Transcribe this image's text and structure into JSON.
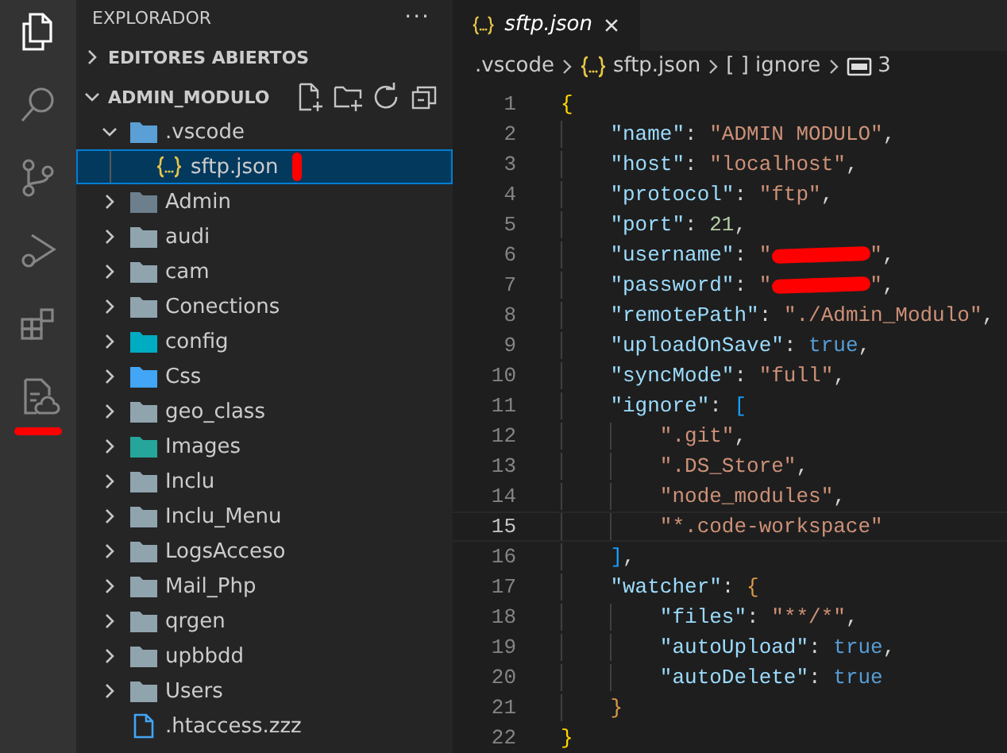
{
  "activity_bar": [
    {
      "kind": "explorer",
      "selected": true,
      "marked": false
    },
    {
      "kind": "search",
      "selected": false,
      "marked": false
    },
    {
      "kind": "source-control",
      "selected": false,
      "marked": false
    },
    {
      "kind": "run",
      "selected": false,
      "marked": false
    },
    {
      "kind": "extensions",
      "selected": false,
      "marked": false
    },
    {
      "kind": "sftp",
      "selected": false,
      "marked": true
    }
  ],
  "sidebar": {
    "title": "EXPLORADOR",
    "more": "···",
    "sections": [
      {
        "label": "EDITORES ABIERTOS",
        "expanded": false
      },
      {
        "label": "ADMIN_MODULO",
        "expanded": true,
        "children": [
          {
            "label": ".vscode",
            "kind": "folder",
            "color": "#5a9fd6",
            "expanded": true,
            "selected": false,
            "marked": false,
            "children": [
              {
                "label": "sftp.json",
                "kind": "json",
                "selected": true,
                "marked": true
              }
            ]
          },
          {
            "label": "Admin",
            "kind": "folder",
            "color": "#6d7f8c",
            "expanded": false,
            "selected": false,
            "marked": false
          },
          {
            "label": "audi",
            "kind": "folder",
            "color": "#90a4ae",
            "expanded": false,
            "selected": false,
            "marked": false
          },
          {
            "label": "cam",
            "kind": "folder",
            "color": "#90a4ae",
            "expanded": false,
            "selected": false,
            "marked": false
          },
          {
            "label": "Conections",
            "kind": "folder",
            "color": "#90a4ae",
            "expanded": false,
            "selected": false,
            "marked": false
          },
          {
            "label": "config",
            "kind": "folder",
            "color": "#00acc1",
            "expanded": false,
            "selected": false,
            "marked": false
          },
          {
            "label": "Css",
            "kind": "folder",
            "color": "#42a5f5",
            "expanded": false,
            "selected": false,
            "marked": false
          },
          {
            "label": "geo_class",
            "kind": "folder",
            "color": "#90a4ae",
            "expanded": false,
            "selected": false,
            "marked": false
          },
          {
            "label": "Images",
            "kind": "folder",
            "color": "#26a69a",
            "expanded": false,
            "selected": false,
            "marked": false
          },
          {
            "label": "Inclu",
            "kind": "folder",
            "color": "#90a4ae",
            "expanded": false,
            "selected": false,
            "marked": false
          },
          {
            "label": "Inclu_Menu",
            "kind": "folder",
            "color": "#90a4ae",
            "expanded": false,
            "selected": false,
            "marked": false
          },
          {
            "label": "LogsAcceso",
            "kind": "folder",
            "color": "#90a4ae",
            "expanded": false,
            "selected": false,
            "marked": false
          },
          {
            "label": "Mail_Php",
            "kind": "folder",
            "color": "#90a4ae",
            "expanded": false,
            "selected": false,
            "marked": false
          },
          {
            "label": "qrgen",
            "kind": "folder",
            "color": "#90a4ae",
            "expanded": false,
            "selected": false,
            "marked": false
          },
          {
            "label": "upbbdd",
            "kind": "folder",
            "color": "#90a4ae",
            "expanded": false,
            "selected": false,
            "marked": false
          },
          {
            "label": "Users",
            "kind": "folder",
            "color": "#90a4ae",
            "expanded": false,
            "selected": false,
            "marked": false
          },
          {
            "label": ".htaccess.zzz",
            "kind": "file",
            "selected": false,
            "marked": false
          }
        ]
      }
    ]
  },
  "editor": {
    "tab": {
      "label": "sftp.json",
      "italic": true
    },
    "breadcrumb": [
      {
        "kind": "folder",
        "label": ".vscode"
      },
      {
        "kind": "json",
        "label": "sftp.json"
      },
      {
        "kind": "array",
        "label": "[ ] ignore"
      },
      {
        "kind": "string",
        "label": "3"
      }
    ],
    "lines": [
      {
        "n": "1",
        "current": false,
        "tokens": [
          {
            "text": "{",
            "kind": "brace"
          }
        ]
      },
      {
        "n": "2",
        "current": false,
        "tokens": [
          {
            "text": "    \"name\"",
            "kind": "key"
          },
          {
            "text": ": ",
            "kind": "punct"
          },
          {
            "text": "\"ADMIN MODULO\"",
            "kind": "string"
          },
          {
            "text": ",",
            "kind": "punct"
          }
        ]
      },
      {
        "n": "3",
        "current": false,
        "tokens": [
          {
            "text": "    \"host\"",
            "kind": "key"
          },
          {
            "text": ": ",
            "kind": "punct"
          },
          {
            "text": "\"localhost\"",
            "kind": "string"
          },
          {
            "text": ",",
            "kind": "punct"
          }
        ]
      },
      {
        "n": "4",
        "current": false,
        "tokens": [
          {
            "text": "    \"protocol\"",
            "kind": "key"
          },
          {
            "text": ": ",
            "kind": "punct"
          },
          {
            "text": "\"ftp\"",
            "kind": "string"
          },
          {
            "text": ",",
            "kind": "punct"
          }
        ]
      },
      {
        "n": "5",
        "current": false,
        "tokens": [
          {
            "text": "    \"port\"",
            "kind": "key"
          },
          {
            "text": ": ",
            "kind": "punct"
          },
          {
            "text": "21",
            "kind": "number"
          },
          {
            "text": ",",
            "kind": "punct"
          }
        ]
      },
      {
        "n": "6",
        "current": false,
        "tokens": [
          {
            "text": "    \"username\"",
            "kind": "key"
          },
          {
            "text": ": ",
            "kind": "punct"
          },
          {
            "text": "\"",
            "kind": "string"
          },
          {
            "kind": "redacted"
          },
          {
            "text": "\"",
            "kind": "string"
          },
          {
            "text": ",",
            "kind": "punct"
          }
        ]
      },
      {
        "n": "7",
        "current": false,
        "tokens": [
          {
            "text": "    \"password\"",
            "kind": "key"
          },
          {
            "text": ": ",
            "kind": "punct"
          },
          {
            "text": "\"",
            "kind": "string"
          },
          {
            "kind": "redacted"
          },
          {
            "text": "\"",
            "kind": "string"
          },
          {
            "text": ",",
            "kind": "punct"
          }
        ]
      },
      {
        "n": "8",
        "current": false,
        "tokens": [
          {
            "text": "    \"remotePath\"",
            "kind": "key"
          },
          {
            "text": ": ",
            "kind": "punct"
          },
          {
            "text": "\"./Admin_Modulo\"",
            "kind": "string"
          },
          {
            "text": ",",
            "kind": "punct"
          }
        ]
      },
      {
        "n": "9",
        "current": false,
        "tokens": [
          {
            "text": "    \"uploadOnSave\"",
            "kind": "key"
          },
          {
            "text": ": ",
            "kind": "punct"
          },
          {
            "text": "true",
            "kind": "bool"
          },
          {
            "text": ",",
            "kind": "punct"
          }
        ]
      },
      {
        "n": "10",
        "current": false,
        "tokens": [
          {
            "text": "    \"syncMode\"",
            "kind": "key"
          },
          {
            "text": ": ",
            "kind": "punct"
          },
          {
            "text": "\"full\"",
            "kind": "string"
          },
          {
            "text": ",",
            "kind": "punct"
          }
        ]
      },
      {
        "n": "11",
        "current": false,
        "tokens": [
          {
            "text": "    \"ignore\"",
            "kind": "key"
          },
          {
            "text": ": ",
            "kind": "punct"
          },
          {
            "text": "[",
            "kind": "bracket"
          }
        ]
      },
      {
        "n": "12",
        "current": false,
        "tokens": [
          {
            "text": "        \".git\"",
            "kind": "string"
          },
          {
            "text": ",",
            "kind": "punct"
          }
        ]
      },
      {
        "n": "13",
        "current": false,
        "tokens": [
          {
            "text": "        \".DS_Store\"",
            "kind": "string"
          },
          {
            "text": ",",
            "kind": "punct"
          }
        ]
      },
      {
        "n": "14",
        "current": false,
        "tokens": [
          {
            "text": "        \"node_modules\"",
            "kind": "string"
          },
          {
            "text": ",",
            "kind": "punct"
          }
        ]
      },
      {
        "n": "15",
        "current": true,
        "tokens": [
          {
            "text": "        \"*.code-workspace\"",
            "kind": "string"
          }
        ]
      },
      {
        "n": "16",
        "current": false,
        "tokens": [
          {
            "text": "    ]",
            "kind": "bracket"
          },
          {
            "text": ",",
            "kind": "punct"
          }
        ]
      },
      {
        "n": "17",
        "current": false,
        "tokens": [
          {
            "text": "    \"watcher\"",
            "kind": "key"
          },
          {
            "text": ": ",
            "kind": "punct"
          },
          {
            "text": "{",
            "kind": "brace2"
          }
        ]
      },
      {
        "n": "18",
        "current": false,
        "tokens": [
          {
            "text": "        \"files\"",
            "kind": "key"
          },
          {
            "text": ": ",
            "kind": "punct"
          },
          {
            "text": "\"**/*\"",
            "kind": "string"
          },
          {
            "text": ",",
            "kind": "punct"
          }
        ]
      },
      {
        "n": "19",
        "current": false,
        "tokens": [
          {
            "text": "        \"autoUpload\"",
            "kind": "key"
          },
          {
            "text": ": ",
            "kind": "punct"
          },
          {
            "text": "true",
            "kind": "bool"
          },
          {
            "text": ",",
            "kind": "punct"
          }
        ]
      },
      {
        "n": "20",
        "current": false,
        "tokens": [
          {
            "text": "        \"autoDelete\"",
            "kind": "key"
          },
          {
            "text": ": ",
            "kind": "punct"
          },
          {
            "text": "true",
            "kind": "bool"
          }
        ]
      },
      {
        "n": "21",
        "current": false,
        "tokens": [
          {
            "text": "    }",
            "kind": "brace2"
          }
        ]
      },
      {
        "n": "22",
        "current": false,
        "tokens": [
          {
            "text": "}",
            "kind": "brace"
          }
        ]
      }
    ]
  }
}
